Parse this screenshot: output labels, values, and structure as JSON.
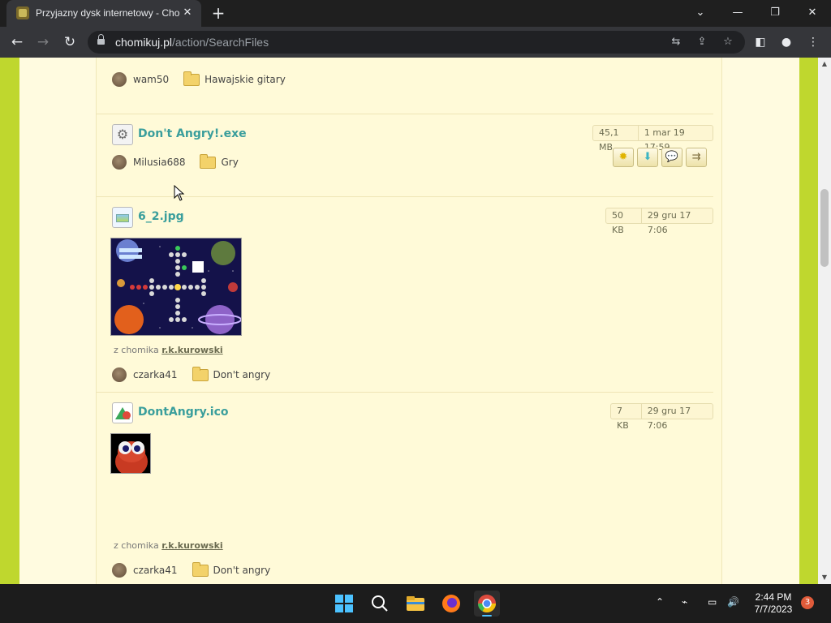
{
  "browser": {
    "tab_title": "Przyjazny dysk internetowy - Cho",
    "url_host": "chomikuj.pl",
    "url_path": "/action/SearchFiles"
  },
  "page": {
    "top_entry": {
      "owner": "wam50",
      "folder": "Hawajskie gitary"
    },
    "files": [
      {
        "name": "Don't Angry!.exe",
        "size": "45,1 MB",
        "date": "1 mar 19 17:59",
        "owner": "Milusia688",
        "folder": "Gry"
      },
      {
        "name": "6_2.jpg",
        "size": "50 KB",
        "date": "29 gru 17 7:06",
        "from_label": "z chomika",
        "from_user": "r.k.kurowski",
        "owner": "czarka41",
        "folder": "Don't angry"
      },
      {
        "name": "DontAngry.ico",
        "size": "7 KB",
        "date": "29 gru 17 7:06",
        "from_label": "z chomika",
        "from_user": "r.k.kurowski",
        "owner": "czarka41",
        "folder": "Don't angry"
      }
    ]
  },
  "taskbar": {
    "time": "2:44 PM",
    "date": "7/7/2023",
    "notifications": "3"
  },
  "colors": {
    "page_bg": "#bfd72e",
    "content_bg": "#fffad8",
    "file_name": "#3a9e9c"
  }
}
